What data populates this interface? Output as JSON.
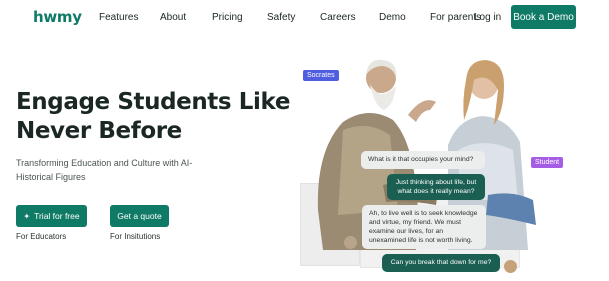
{
  "nav": {
    "logo": "hwmy",
    "links": [
      "Features",
      "About",
      "Pricing",
      "Safety",
      "Careers",
      "Demo",
      "For parents",
      "Log in"
    ],
    "cta": "Book a Demo"
  },
  "hero": {
    "headline_line1": "Engage Students Like",
    "headline_line2": "Never Before",
    "subhead": "Transforming Education and Culture with AI-Historical Figures",
    "primary_button": "Trial for free",
    "primary_caption": "For Educators",
    "secondary_button": "Get a quote",
    "secondary_caption": "For Insitutions"
  },
  "illustration": {
    "tag_left": "Socrates",
    "tag_right": "Student",
    "messages": [
      "What is it that occupies your mind?",
      "Just thinking about life, but what does it really mean?",
      "Ah, to live well is to seek knowledge and virtue, my friend. We must examine our lives, for an unexamined life is not worth living.",
      "Can you break that down for me?"
    ]
  },
  "colors": {
    "brand": "#0f7a66",
    "tag_socrates": "#4f5ee0",
    "tag_student": "#a65de6"
  }
}
